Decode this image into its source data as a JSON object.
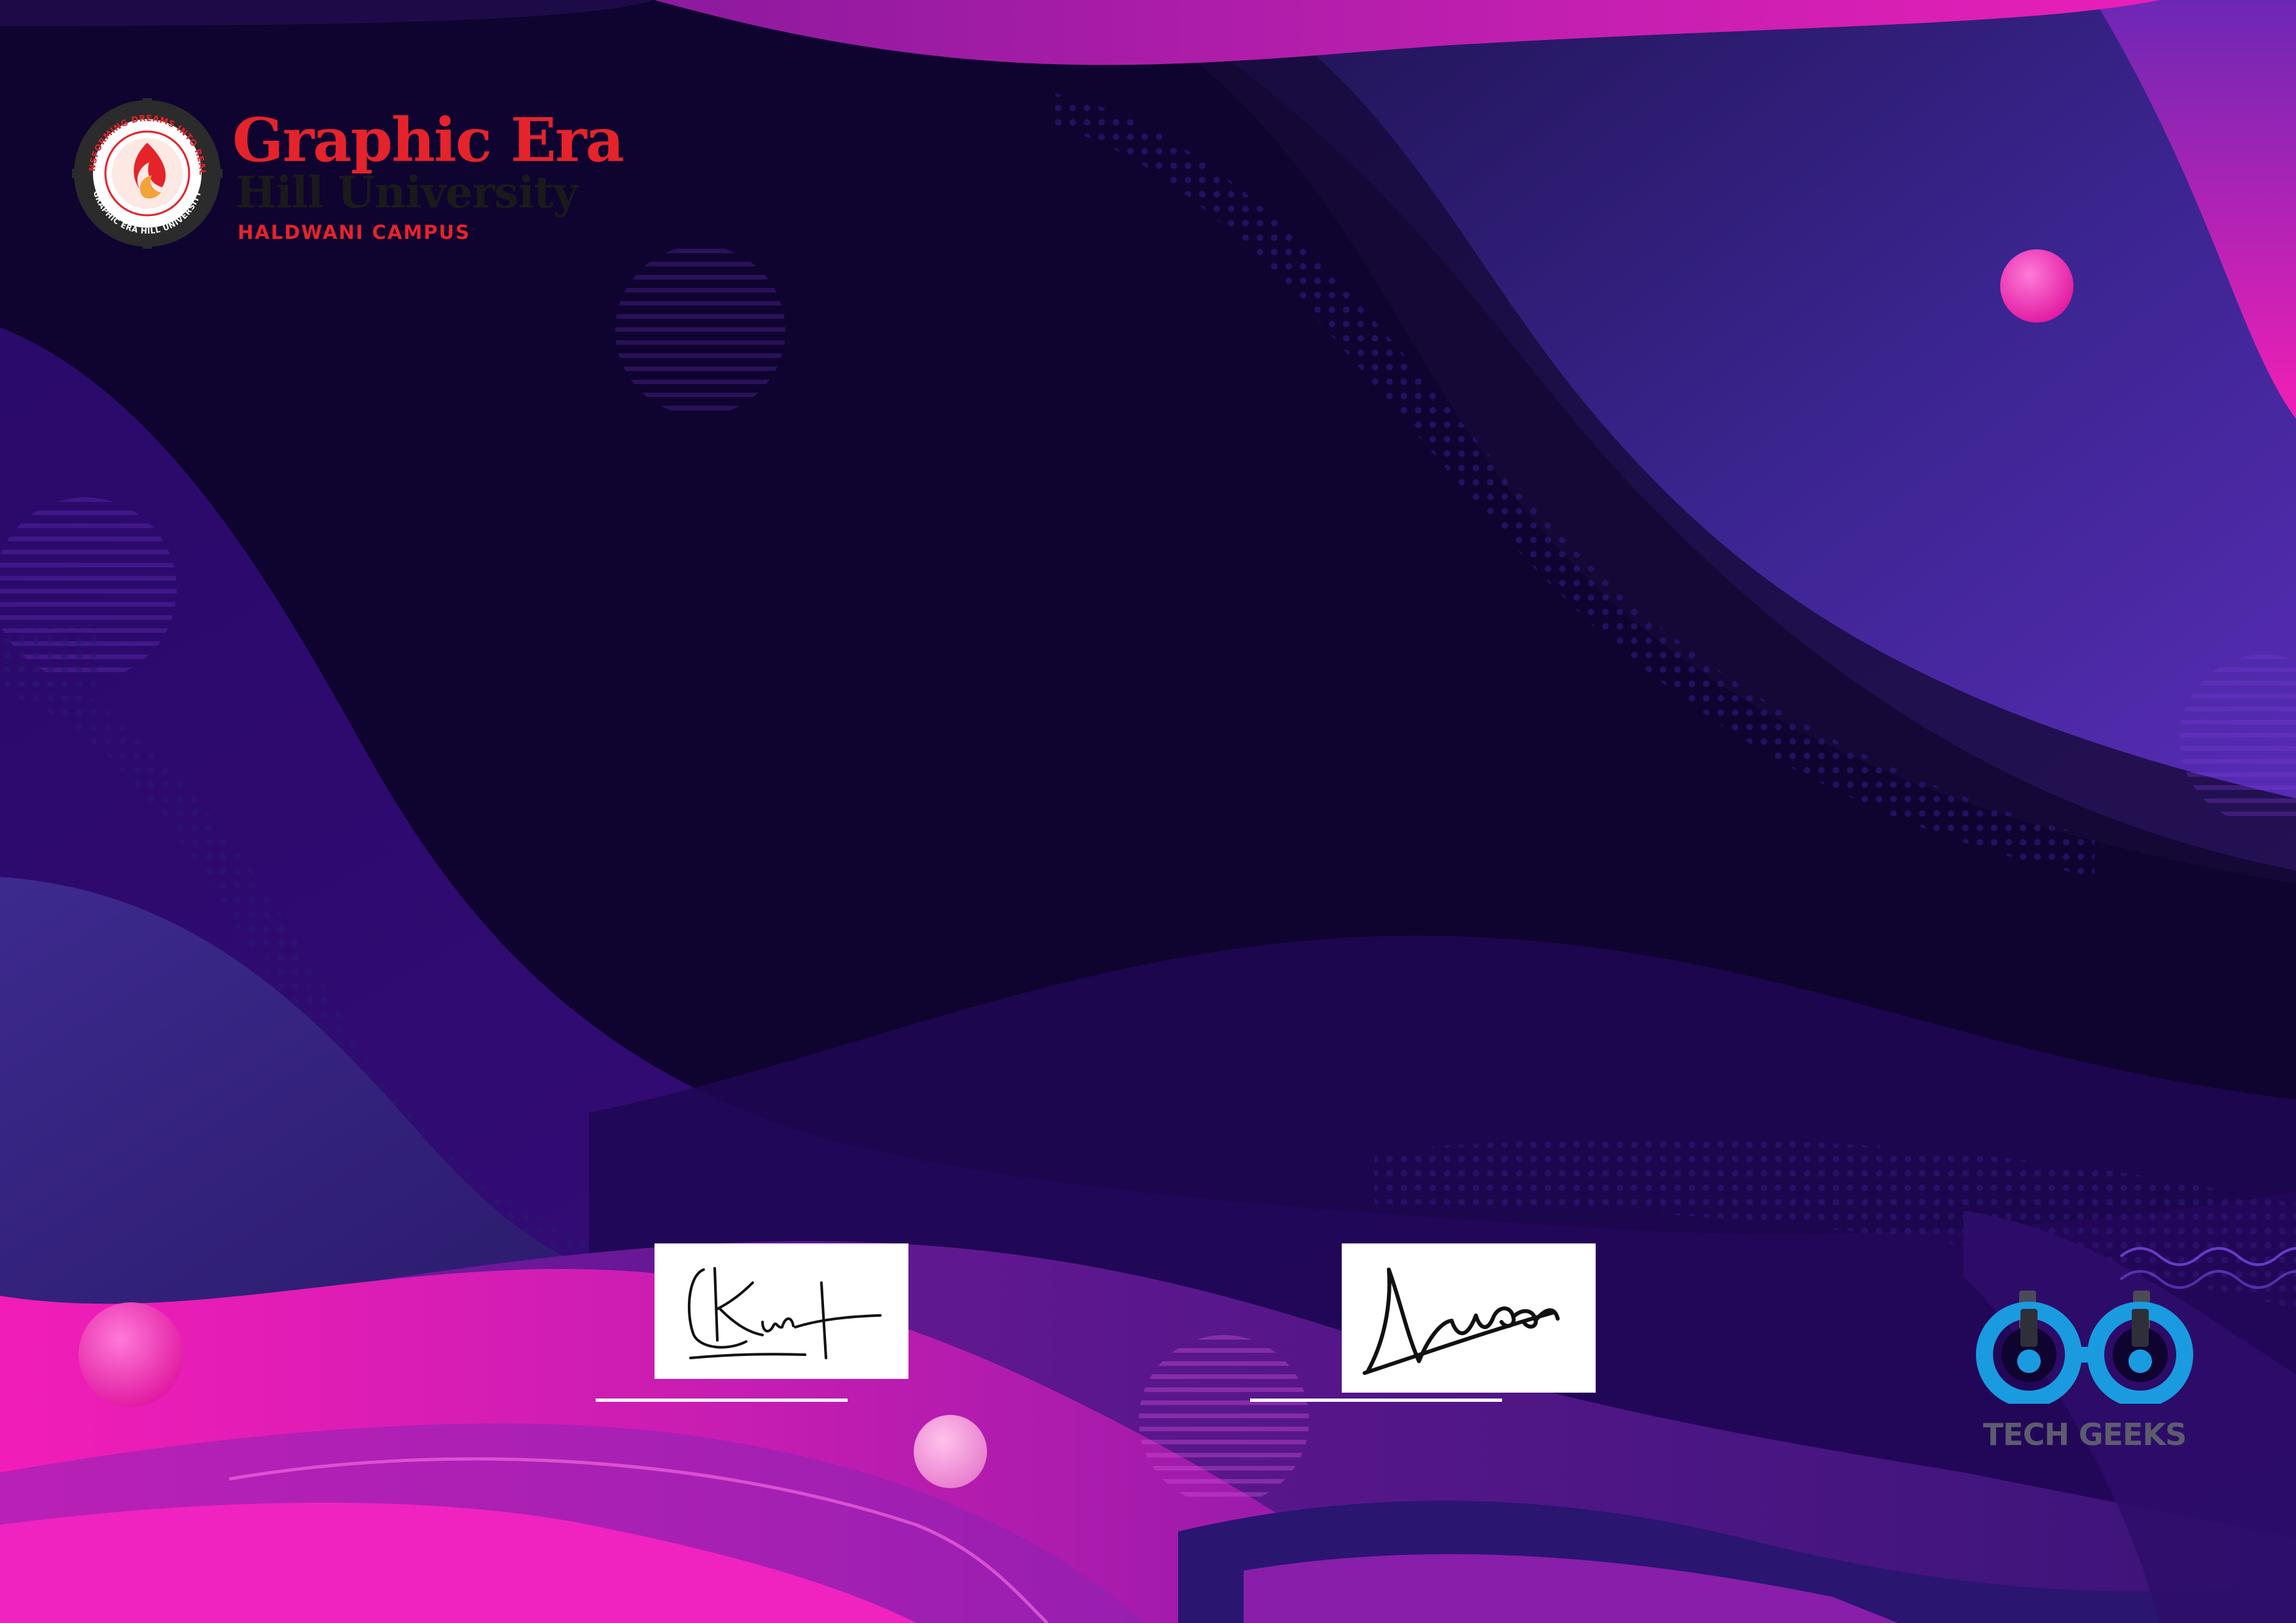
{
  "university": {
    "name": "Graphic Era",
    "subname": "Hill University",
    "campus": "HALDWANI CAMPUS",
    "seal_outer_text": "TRANSFORMING DREAMS INTO REALITY",
    "seal_inner_text": "GRAPHIC ERA HILL UNIVERSITY",
    "brand_color": "#e5232b"
  },
  "signatures": [
    {
      "name": "signature-left"
    },
    {
      "name": "signature-right"
    }
  ],
  "tech_geeks": {
    "label": "TECH GEEKS",
    "icon": "goggles-icon",
    "color": "#1a9be0"
  },
  "colors": {
    "background": "#0f0330",
    "magenta": "#f01fb5",
    "purple": "#6a1aa8",
    "violet": "#3a1a8a"
  }
}
